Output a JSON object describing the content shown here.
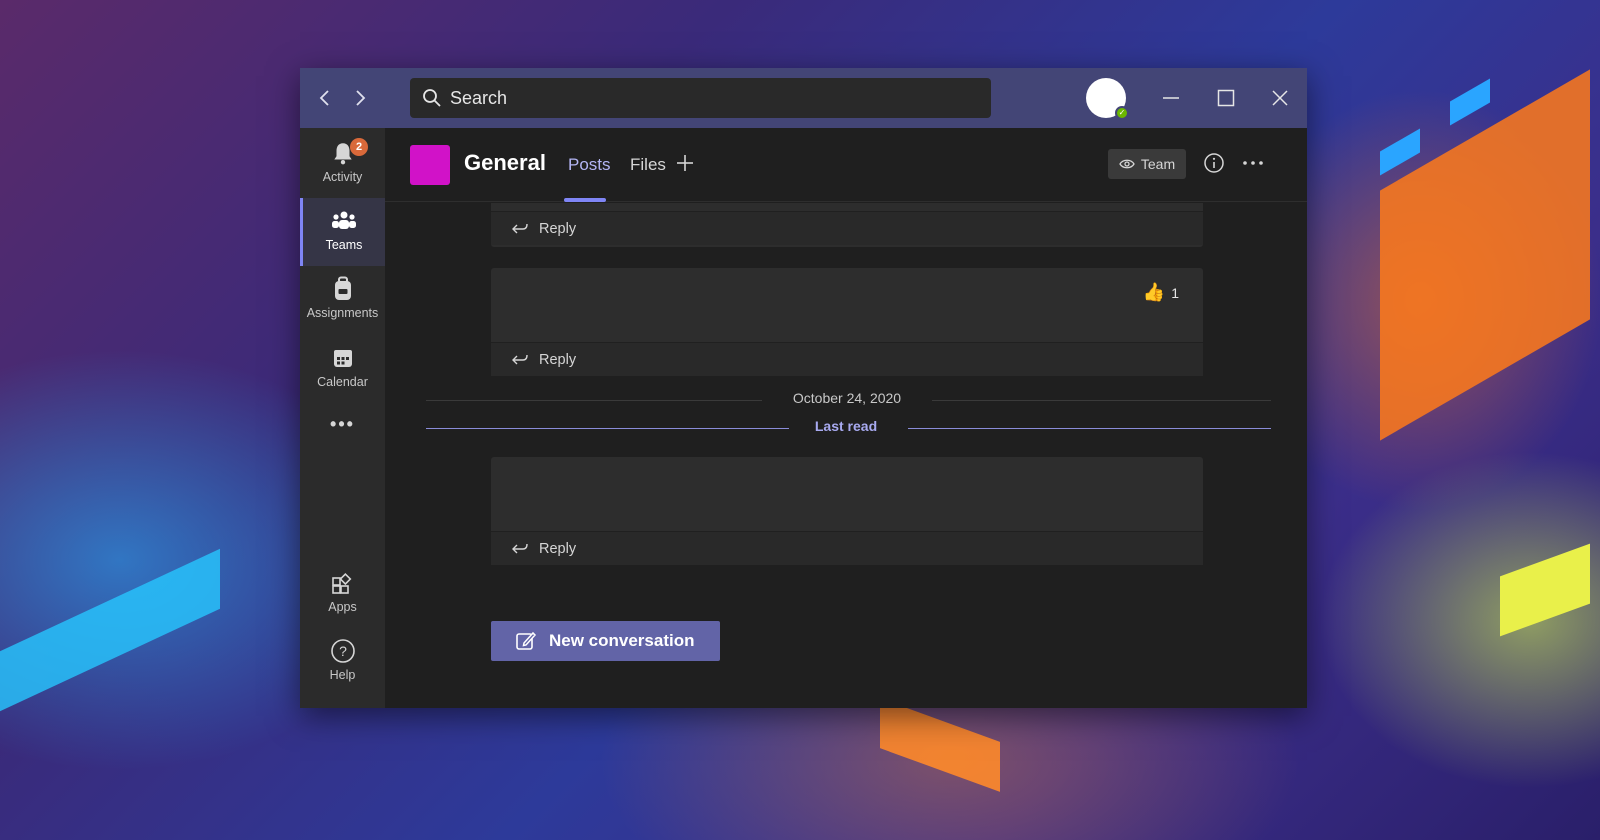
{
  "search": {
    "placeholder": "Search"
  },
  "rail": {
    "activity": {
      "label": "Activity",
      "badge": "2"
    },
    "teams": {
      "label": "Teams"
    },
    "assignments": {
      "label": "Assignments"
    },
    "calendar": {
      "label": "Calendar"
    },
    "more": {
      "label": "•••"
    },
    "apps": {
      "label": "Apps"
    },
    "help": {
      "label": "Help"
    }
  },
  "channel": {
    "name": "General",
    "tabs": [
      "Posts",
      "Files"
    ],
    "team_button": "Team"
  },
  "posts": {
    "reply_label": "Reply",
    "reaction_count": "1",
    "date_divider": "October 24, 2020",
    "last_read": "Last read"
  },
  "new_conversation": "New conversation",
  "colors": {
    "accent": "#6264a7",
    "titlebar": "#434576",
    "team_tile": "#d112c8",
    "presence": "#6bb700",
    "badge": "#d9693a"
  },
  "icons": [
    "back-arrow-icon",
    "forward-arrow-icon",
    "search-icon",
    "minimize-icon",
    "maximize-icon",
    "close-icon",
    "bell-icon",
    "teams-icon",
    "backpack-icon",
    "calendar-icon",
    "apps-icon",
    "help-icon",
    "eye-icon",
    "info-icon",
    "reply-icon",
    "thumbs-up-icon",
    "compose-icon"
  ]
}
